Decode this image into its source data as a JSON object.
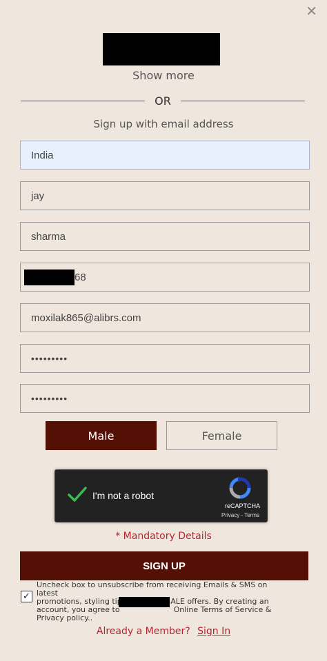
{
  "dialog": {
    "close_glyph": "✕"
  },
  "social": {
    "show_more": "Show more"
  },
  "divider": {
    "or": "OR"
  },
  "form": {
    "title": "Sign up with email address",
    "country": "India",
    "first_name": "jay",
    "last_name": "sharma",
    "phone_suffix": "68",
    "email": "moxilak865@alibrs.com",
    "password_mask": "•••••••••",
    "confirm_password_mask": "•••••••••"
  },
  "gender": {
    "male": "Male",
    "female": "Female",
    "selected": "Male"
  },
  "captcha": {
    "label": "I'm not a robot",
    "brand": "reCAPTCHA",
    "links": "Privacy - Terms",
    "checked": true
  },
  "mandatory": "* Mandatory Details",
  "signup_button": "SIGN UP",
  "consent": {
    "checked": true,
    "check_glyph": "✓",
    "line1": "Uncheck box to unsubscribe from receiving Emails & SMS on latest",
    "line2": "promotions, styling tips, trends & SALE offers. By creating an",
    "line3_before": "account, you agree to",
    "line3_after": "Online Terms of Service &",
    "line4": "Privacy policy.."
  },
  "footer": {
    "already_member": "Already a Member?",
    "sign_in": "Sign In"
  },
  "colors": {
    "background": "#efe6dd",
    "brand": "#541005",
    "accent_red": "#b3262e"
  }
}
